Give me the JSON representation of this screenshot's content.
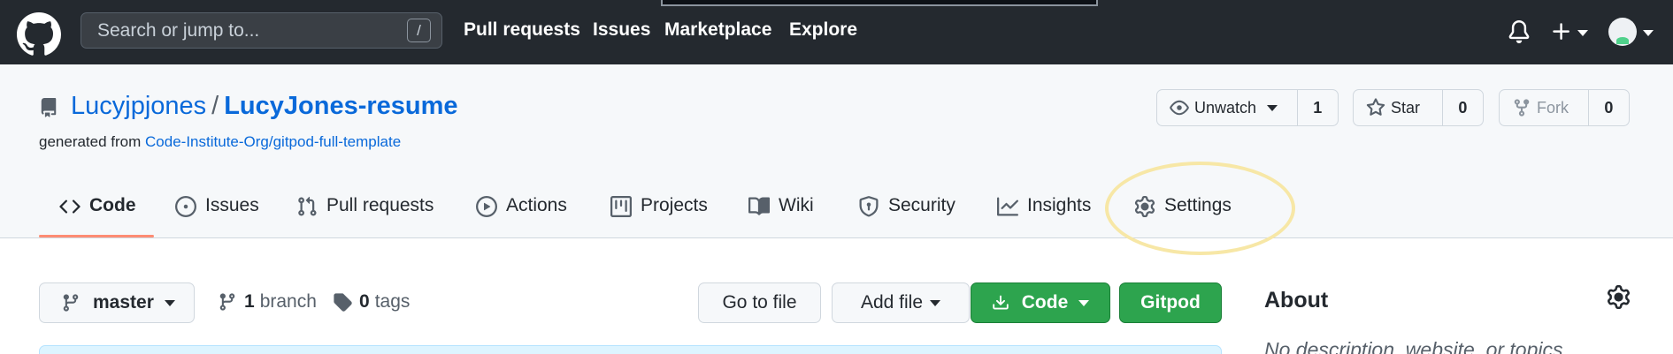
{
  "header": {
    "search_placeholder": "Search or jump to...",
    "search_shortcut": "/",
    "nav": [
      "Pull requests",
      "Issues",
      "Marketplace",
      "Explore"
    ]
  },
  "repo": {
    "owner": "Lucyjpjones",
    "separator": "/",
    "name": "LucyJones-resume",
    "generated_prefix": "generated from",
    "template_link": "Code-Institute-Org/gitpod-full-template",
    "watch": {
      "label": "Unwatch",
      "count": "1"
    },
    "star": {
      "label": "Star",
      "count": "0"
    },
    "fork": {
      "label": "Fork",
      "count": "0"
    }
  },
  "tabs": [
    {
      "label": "Code",
      "icon": "code-icon",
      "active": true
    },
    {
      "label": "Issues",
      "icon": "issue-icon"
    },
    {
      "label": "Pull requests",
      "icon": "pull-request-icon"
    },
    {
      "label": "Actions",
      "icon": "play-icon"
    },
    {
      "label": "Projects",
      "icon": "project-icon"
    },
    {
      "label": "Wiki",
      "icon": "book-icon"
    },
    {
      "label": "Security",
      "icon": "shield-icon"
    },
    {
      "label": "Insights",
      "icon": "graph-icon"
    },
    {
      "label": "Settings",
      "icon": "gear-icon"
    }
  ],
  "toolbar": {
    "branch": "master",
    "branch_count": "1",
    "branch_word": "branch",
    "tag_count": "0",
    "tag_word": "tags",
    "go_to_file": "Go to file",
    "add_file": "Add file",
    "code": "Code",
    "gitpod": "Gitpod"
  },
  "about": {
    "title": "About",
    "description": "No description, website, or topics"
  },
  "colors": {
    "header_bg": "#24292f",
    "link": "#0969da",
    "green": "#2da44e",
    "active_tab": "#fd8c73",
    "highlight": "#f7e7a6"
  }
}
